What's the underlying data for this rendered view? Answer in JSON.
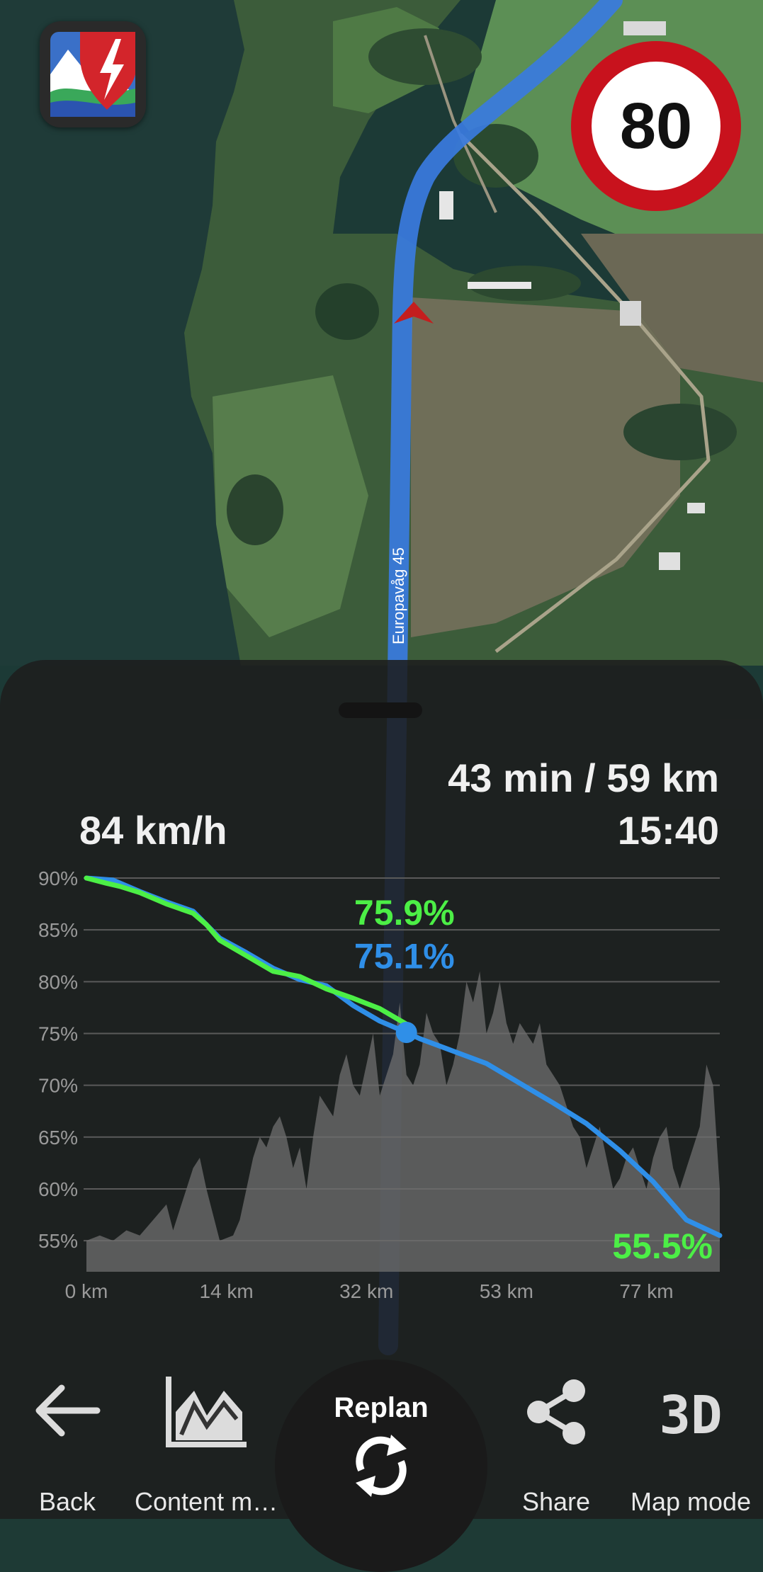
{
  "map": {
    "road_label": "Europavåg 45"
  },
  "speed_limit": "80",
  "panel": {
    "eta_distance": "43 min / 59 km",
    "arrival_time": "15:40",
    "current_speed": "84 km/h"
  },
  "chart_data": {
    "type": "line",
    "ylim": [
      52,
      90
    ],
    "xlim": [
      0,
      95
    ],
    "yticks": [
      "90%",
      "85%",
      "80%",
      "75%",
      "70%",
      "65%",
      "60%",
      "55%"
    ],
    "ytick_values": [
      90,
      85,
      80,
      75,
      70,
      65,
      60,
      55
    ],
    "xticks": [
      "0 km",
      "14 km",
      "32 km",
      "53 km",
      "77 km"
    ],
    "xtick_values": [
      0,
      21,
      42,
      63,
      84
    ],
    "annotations": {
      "actual": "75.9%",
      "predicted": "75.1%",
      "final": "55.5%"
    },
    "colors": {
      "actual": "#4cef46",
      "predicted": "#2f8fe8",
      "elevation": "#6f6f6f"
    },
    "series": [
      {
        "x": [
          0,
          3,
          5,
          8,
          12,
          16,
          18,
          20,
          24,
          28,
          32,
          36,
          40,
          44,
          48
        ],
        "y": [
          90,
          89.5,
          89.2,
          88.6,
          87.5,
          86.6,
          85.5,
          84,
          82.5,
          81,
          80.5,
          79.3,
          78.4,
          77.4,
          75.9
        ]
      },
      {
        "x": [
          0,
          4,
          8,
          12,
          16,
          18,
          20,
          24,
          28,
          32,
          36,
          40,
          44,
          48,
          50,
          55,
          60,
          65,
          70,
          75,
          80,
          85,
          90,
          95
        ],
        "y": [
          90,
          89.8,
          88.7,
          87.7,
          86.8,
          85.5,
          84.2,
          82.8,
          81.3,
          80.2,
          79.6,
          77.7,
          76.2,
          75.1,
          74.5,
          73.3,
          72.1,
          70.2,
          68.3,
          66.3,
          63.7,
          60.7,
          57.0,
          55.5
        ]
      },
      {
        "x": [
          0,
          2,
          4,
          6,
          8,
          10,
          12,
          13,
          14,
          15,
          16,
          17,
          18,
          20,
          22,
          23,
          24,
          25,
          26,
          27,
          28,
          29,
          30,
          31,
          32,
          33,
          34,
          35,
          36,
          37,
          38,
          39,
          40,
          41,
          42,
          43,
          44,
          45,
          46,
          47,
          48,
          49,
          50,
          51,
          52,
          53,
          54,
          55,
          56,
          57,
          58,
          59,
          60,
          61,
          62,
          63,
          64,
          65,
          66,
          67,
          68,
          69,
          70,
          71,
          72,
          73,
          74,
          75,
          76,
          77,
          78,
          79,
          80,
          81,
          82,
          83,
          84,
          85,
          86,
          87,
          88,
          89,
          90,
          91,
          92,
          93,
          94,
          95
        ],
        "y": [
          55,
          55.5,
          55,
          56,
          55.5,
          57,
          58.5,
          56,
          58,
          60,
          62,
          63,
          60,
          55,
          55.5,
          57,
          60,
          63,
          65,
          64,
          66,
          67,
          65,
          62,
          64,
          60,
          65,
          69,
          68,
          67,
          71,
          73,
          70,
          69,
          72,
          75,
          69,
          71,
          73,
          78,
          71,
          70,
          72,
          77,
          75,
          74,
          70,
          72,
          75,
          80,
          78,
          81,
          75,
          77,
          80,
          76,
          74,
          76,
          75,
          74,
          76,
          72,
          71,
          70,
          68,
          66,
          65,
          62,
          64,
          66,
          63,
          60,
          61,
          63,
          64,
          62,
          60,
          63,
          65,
          66,
          62,
          60,
          62,
          64,
          66,
          72,
          70,
          60
        ]
      }
    ],
    "grid": true
  },
  "bottom_bar": {
    "back_label": "Back",
    "content_label": "Content m…",
    "replan_label": "Replan",
    "share_label": "Share",
    "mapmode_label": "Map mode",
    "mapmode_icon_text": "3D"
  }
}
